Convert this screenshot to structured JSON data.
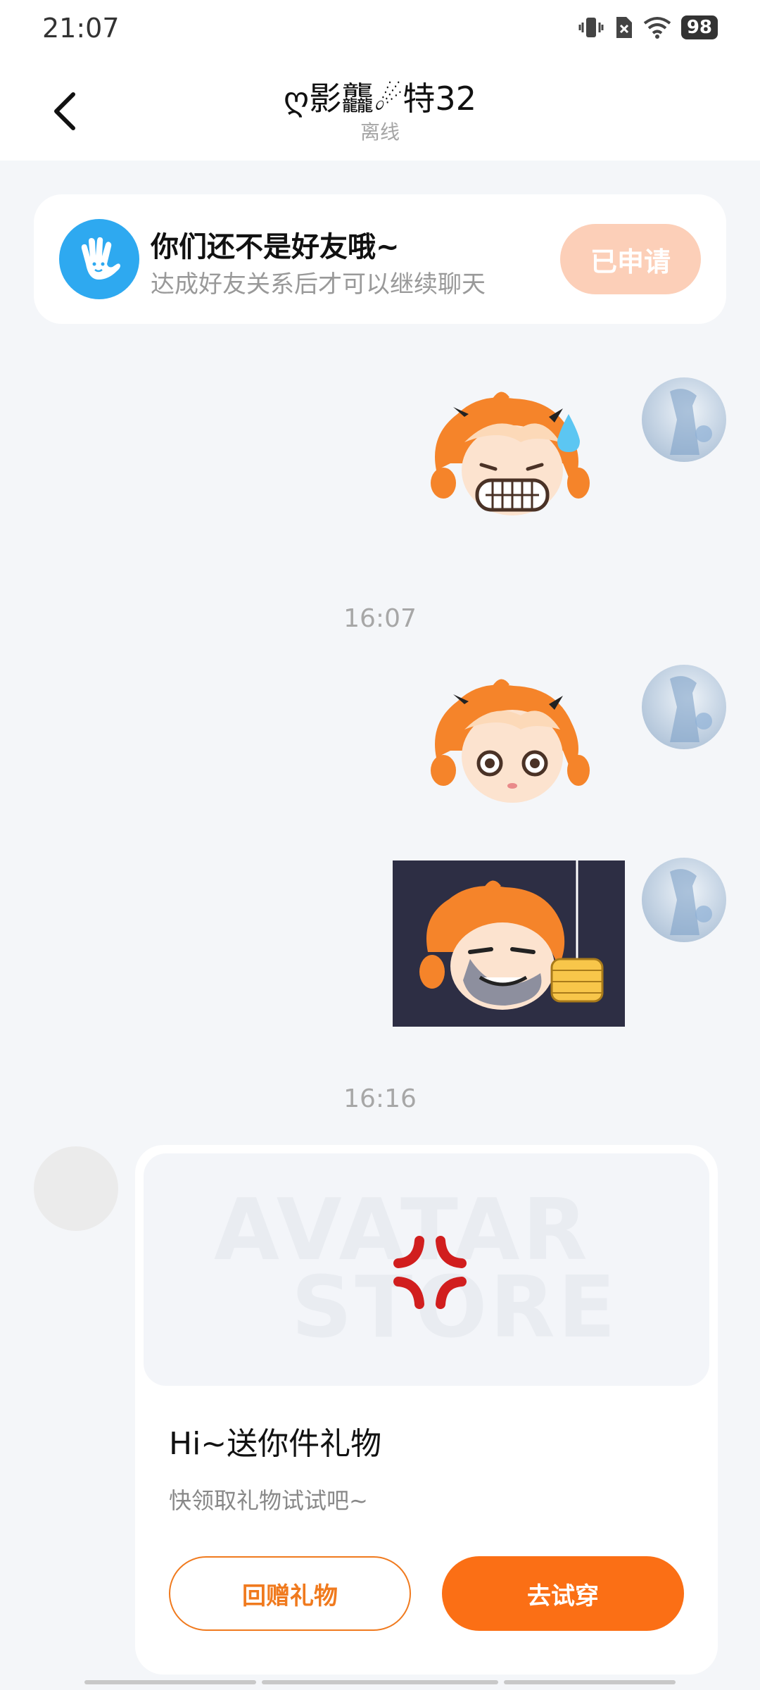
{
  "status_bar": {
    "time": "21:07",
    "battery": "98",
    "icons": [
      "vibrate-icon",
      "no-sim-icon",
      "wifi-icon",
      "battery-icon"
    ]
  },
  "header": {
    "title": "ღ影龘☄特32",
    "subtitle": "离线",
    "back_icon": "chevron-left-icon"
  },
  "friend_banner": {
    "title": "你们还不是好友哦~",
    "description": "达成好友关系后才可以继续聊天",
    "button_label": "已申请",
    "icon": "wave-hand-icon"
  },
  "messages": {
    "timestamps": [
      "16:07",
      "16:16"
    ]
  },
  "gift_card": {
    "watermark_line1": "AVATAR",
    "watermark_line2": "STORE",
    "title": "Hi~送你件礼物",
    "subtitle": "快领取礼物试试吧~",
    "return_gift_label": "回赠礼物",
    "try_on_label": "去试穿"
  },
  "colors": {
    "accent_orange": "#fb6f15",
    "applied_button": "#fccfb8",
    "banner_icon_blue": "#2ea9f0",
    "background": "#f4f6f9"
  }
}
